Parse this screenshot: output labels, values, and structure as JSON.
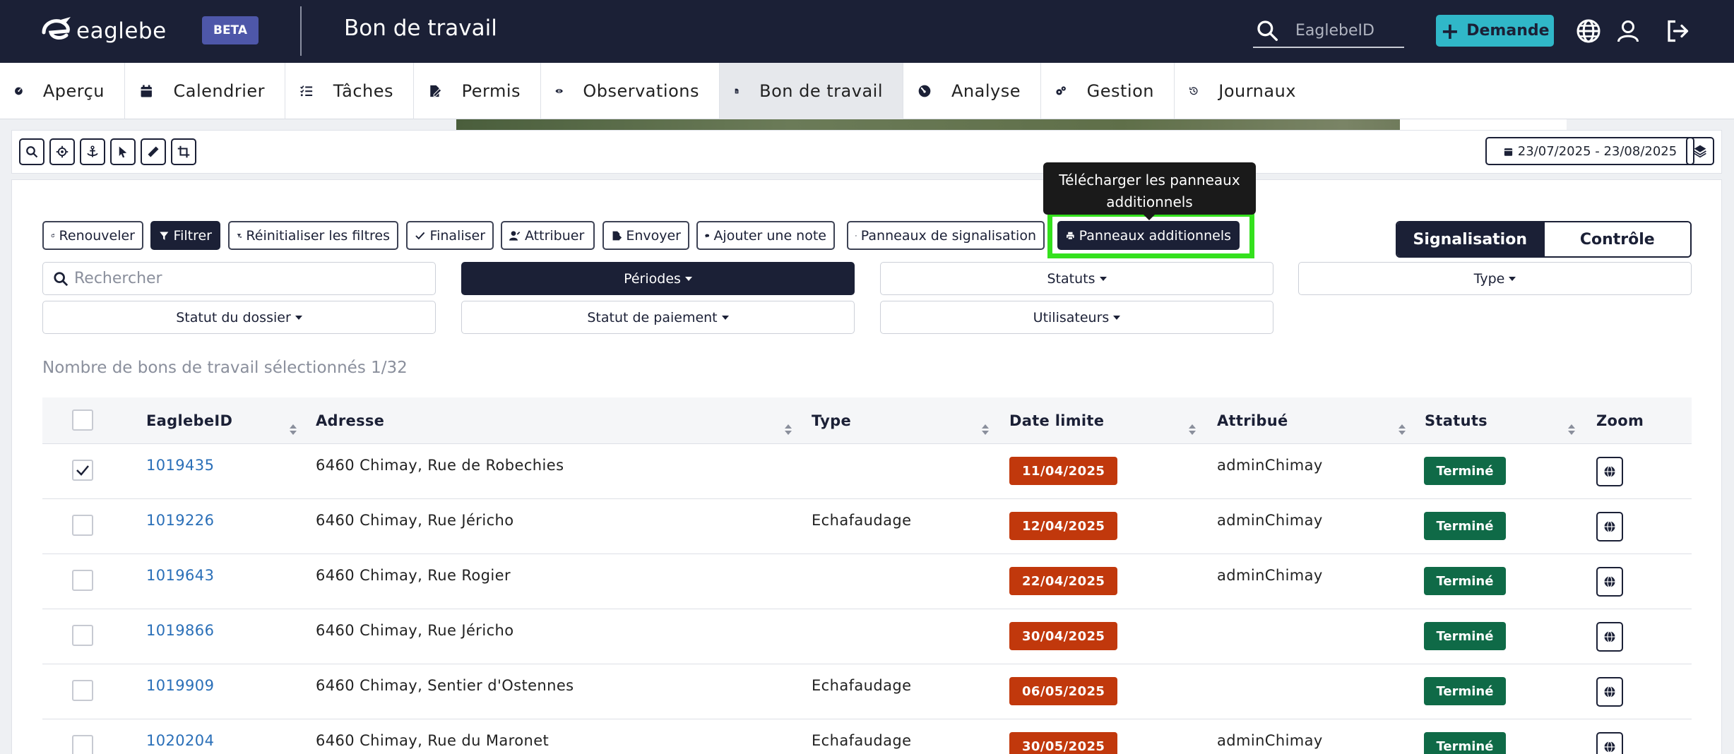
{
  "app": {
    "logo_text": "eaglebe",
    "beta_label": "BETA",
    "page_title": "Bon de travail",
    "search_placeholder": "EaglebeID",
    "demande_label": "Demande"
  },
  "nav": [
    {
      "label": "Aperçu",
      "icon": "dashboard-icon"
    },
    {
      "label": "Calendrier",
      "icon": "calendar-icon"
    },
    {
      "label": "Tâches",
      "icon": "tasks-icon"
    },
    {
      "label": "Permis",
      "icon": "permit-icon"
    },
    {
      "label": "Observations",
      "icon": "eye-icon"
    },
    {
      "label": "Bon de travail",
      "icon": "document-icon",
      "active": true
    },
    {
      "label": "Analyse",
      "icon": "gauge-icon"
    },
    {
      "label": "Gestion",
      "icon": "gears-icon"
    },
    {
      "label": "Journaux",
      "icon": "history-icon"
    }
  ],
  "map_toolbar": {
    "tools": [
      "search-icon",
      "locate-icon",
      "anchor-icon",
      "pointer-icon",
      "ruler-icon",
      "crop-icon"
    ],
    "date_range": "23/07/2025 - 23/08/2025"
  },
  "actions": {
    "renouveler": "Renouveler",
    "filtrer": "Filtrer",
    "reinitialiser": "Réinitialiser les filtres",
    "finaliser": "Finaliser",
    "attribuer": "Attribuer",
    "envoyer": "Envoyer",
    "ajouter_note": "Ajouter une note",
    "panneaux_signalisation": "Panneaux de signalisation",
    "panneaux_additionnels": "Panneaux additionnels"
  },
  "tooltip": {
    "line1": "Télécharger les panneaux",
    "line2": "additionnels"
  },
  "toggle": {
    "signalisation": "Signalisation",
    "controle": "Contrôle"
  },
  "filters": {
    "search_placeholder": "Rechercher",
    "periodes": "Périodes",
    "statuts": "Statuts",
    "type": "Type",
    "statut_dossier": "Statut du dossier",
    "statut_paiement": "Statut de paiement",
    "utilisateurs": "Utilisateurs"
  },
  "count_text": "Nombre de bons de travail sélectionnés 1/32",
  "table": {
    "headers": {
      "id": "EaglebeID",
      "adresse": "Adresse",
      "type": "Type",
      "date": "Date limite",
      "attribue": "Attribué",
      "statuts": "Statuts",
      "zoom": "Zoom"
    },
    "rows": [
      {
        "id": "1019435",
        "adresse": "6460 Chimay, Rue de Robechies",
        "type": "",
        "date": "11/04/2025",
        "attribue": "adminChimay",
        "statut": "Terminé",
        "checked": true
      },
      {
        "id": "1019226",
        "adresse": "6460 Chimay, Rue Jéricho",
        "type": "Echafaudage",
        "date": "12/04/2025",
        "attribue": "adminChimay",
        "statut": "Terminé",
        "checked": false
      },
      {
        "id": "1019643",
        "adresse": "6460 Chimay, Rue Rogier",
        "type": "",
        "date": "22/04/2025",
        "attribue": "adminChimay",
        "statut": "Terminé",
        "checked": false
      },
      {
        "id": "1019866",
        "adresse": "6460 Chimay, Rue Jéricho",
        "type": "",
        "date": "30/04/2025",
        "attribue": "",
        "statut": "Terminé",
        "checked": false
      },
      {
        "id": "1019909",
        "adresse": "6460 Chimay, Sentier d'Ostennes",
        "type": "Echafaudage",
        "date": "06/05/2025",
        "attribue": "",
        "statut": "Terminé",
        "checked": false
      },
      {
        "id": "1020204",
        "adresse": "6460 Chimay, Rue du Maronet",
        "type": "Echafaudage",
        "date": "30/05/2025",
        "attribue": "adminChimay",
        "statut": "Terminé",
        "checked": false
      }
    ]
  },
  "colors": {
    "navy": "#1b2036",
    "accent": "#30b7c8",
    "date_badge": "#c1380c",
    "status_badge": "#0f6a47",
    "highlight": "#34e11d",
    "link": "#2a6fb8"
  }
}
